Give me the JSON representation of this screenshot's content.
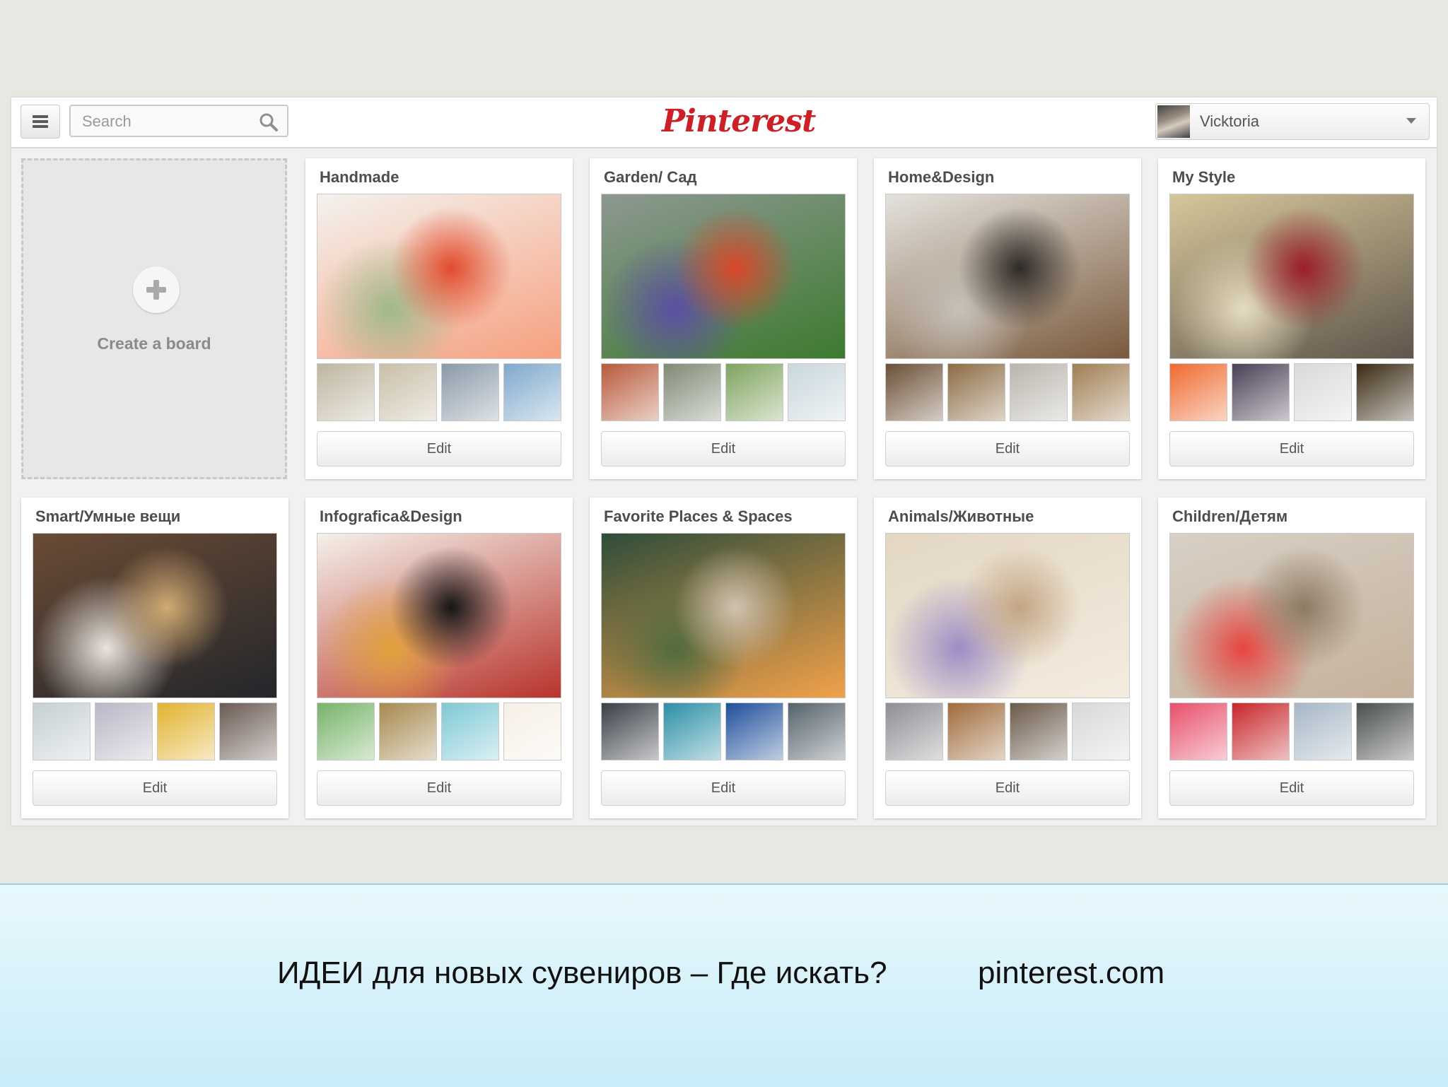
{
  "header": {
    "search_placeholder": "Search",
    "logo_text": "Pinterest",
    "user_name": "Vicktoria"
  },
  "create_board": {
    "label": "Create a board"
  },
  "boards": [
    {
      "title": "Handmade",
      "edit_label": "Edit",
      "cover": [
        "#f4f2ee",
        "#e14b2d",
        "#f7a07f",
        "#9fb98b"
      ],
      "thumbs": [
        "#bfb6a0",
        "#c9bea7",
        "#8a9aa8",
        "#7fa9cc"
      ]
    },
    {
      "title": "Garden/ Сад",
      "edit_label": "Edit",
      "cover": [
        "#8d9891",
        "#d9472a",
        "#3d7a2f",
        "#5b4fa3"
      ],
      "thumbs": [
        "#b85a3a",
        "#7f8a75",
        "#7fa45e",
        "#c9d7dc"
      ]
    },
    {
      "title": "Home&Design",
      "edit_label": "Edit",
      "cover": [
        "#e4e2dd",
        "#2e2a27",
        "#7a5a3d",
        "#c6c1b9"
      ],
      "thumbs": [
        "#6b4f35",
        "#8c6b43",
        "#b9b5ad",
        "#a07e52"
      ]
    },
    {
      "title": "My Style",
      "edit_label": "Edit",
      "cover": [
        "#d6c79a",
        "#9c1d29",
        "#5f554b",
        "#e6dcc0"
      ],
      "thumbs": [
        "#ef6a2f",
        "#4a3f55",
        "#d9d9d9",
        "#3a2a12"
      ]
    },
    {
      "title": "Smart/Умные вещи",
      "edit_label": "Edit",
      "cover": [
        "#6a4b35",
        "#d2ab73",
        "#24262b",
        "#e9e4dd"
      ],
      "thumbs": [
        "#c5cfd3",
        "#b8b8c7",
        "#e2b32f",
        "#6a5a52"
      ]
    },
    {
      "title": "Infografica&Design",
      "edit_label": "Edit",
      "cover": [
        "#f4f1ea",
        "#151515",
        "#b8342c",
        "#e2a23c"
      ],
      "thumbs": [
        "#76b468",
        "#a6894e",
        "#7ec9d6",
        "#f6efe6"
      ]
    },
    {
      "title": "Favorite Places & Spaces",
      "edit_label": "Edit",
      "cover": [
        "#2e4d3a",
        "#cfc2b0",
        "#f2a14a",
        "#516b3f"
      ],
      "thumbs": [
        "#3a3e46",
        "#2a8fa6",
        "#1f4f9b",
        "#55626b"
      ]
    },
    {
      "title": "Animals/Животные",
      "edit_label": "Edit",
      "cover": [
        "#e3d7c3",
        "#c3a584",
        "#f4ece0",
        "#9e8cc4"
      ],
      "thumbs": [
        "#8d8f93",
        "#a06b3a",
        "#6b5a4a",
        "#d8d8d8"
      ]
    },
    {
      "title": "Children/Детям",
      "edit_label": "Edit",
      "cover": [
        "#d8d0c6",
        "#8d7a63",
        "#c4b19b",
        "#e7453f"
      ],
      "thumbs": [
        "#e84f6b",
        "#c8262a",
        "#a6b7c6",
        "#4a4f4b"
      ]
    }
  ],
  "footer": {
    "caption": "ИДЕИ для новых сувениров – Где искать?",
    "url": "pinterest.com"
  }
}
